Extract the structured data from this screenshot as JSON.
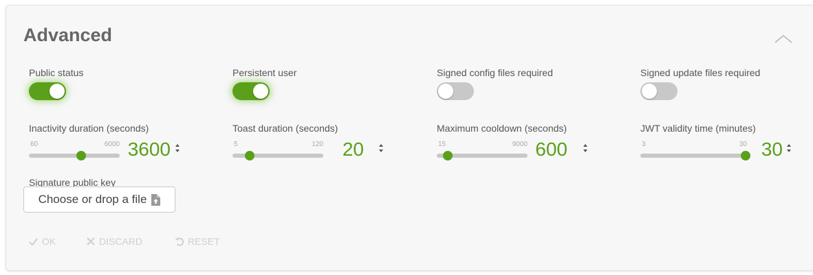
{
  "section": {
    "title": "Advanced",
    "collapse_icon": "chevron-up-icon"
  },
  "toggles": [
    {
      "label": "Public status",
      "on": true
    },
    {
      "label": "Persistent user",
      "on": true
    },
    {
      "label": "Signed config files required",
      "on": false
    },
    {
      "label": "Signed update files required",
      "on": false
    }
  ],
  "sliders": [
    {
      "label": "Inactivity duration (seconds)",
      "min": "60",
      "max": "6000",
      "value": "3600"
    },
    {
      "label": "Toast duration (seconds)",
      "min": "5",
      "max": "120",
      "value": "20"
    },
    {
      "label": "Maximum cooldown (seconds)",
      "min": "15",
      "max": "9000",
      "value": "600"
    },
    {
      "label": "JWT validity time (minutes)",
      "min": "3",
      "max": "30",
      "value": "30"
    }
  ],
  "signature": {
    "label": "Signature public key",
    "file_button": "Choose or drop a file",
    "file_icon": "file-upload-icon"
  },
  "actions": {
    "ok": "OK",
    "discard": "DISCARD",
    "reset": "RESET"
  },
  "colors": {
    "accent": "#5aa01a",
    "disabled": "#cfcfcf"
  }
}
